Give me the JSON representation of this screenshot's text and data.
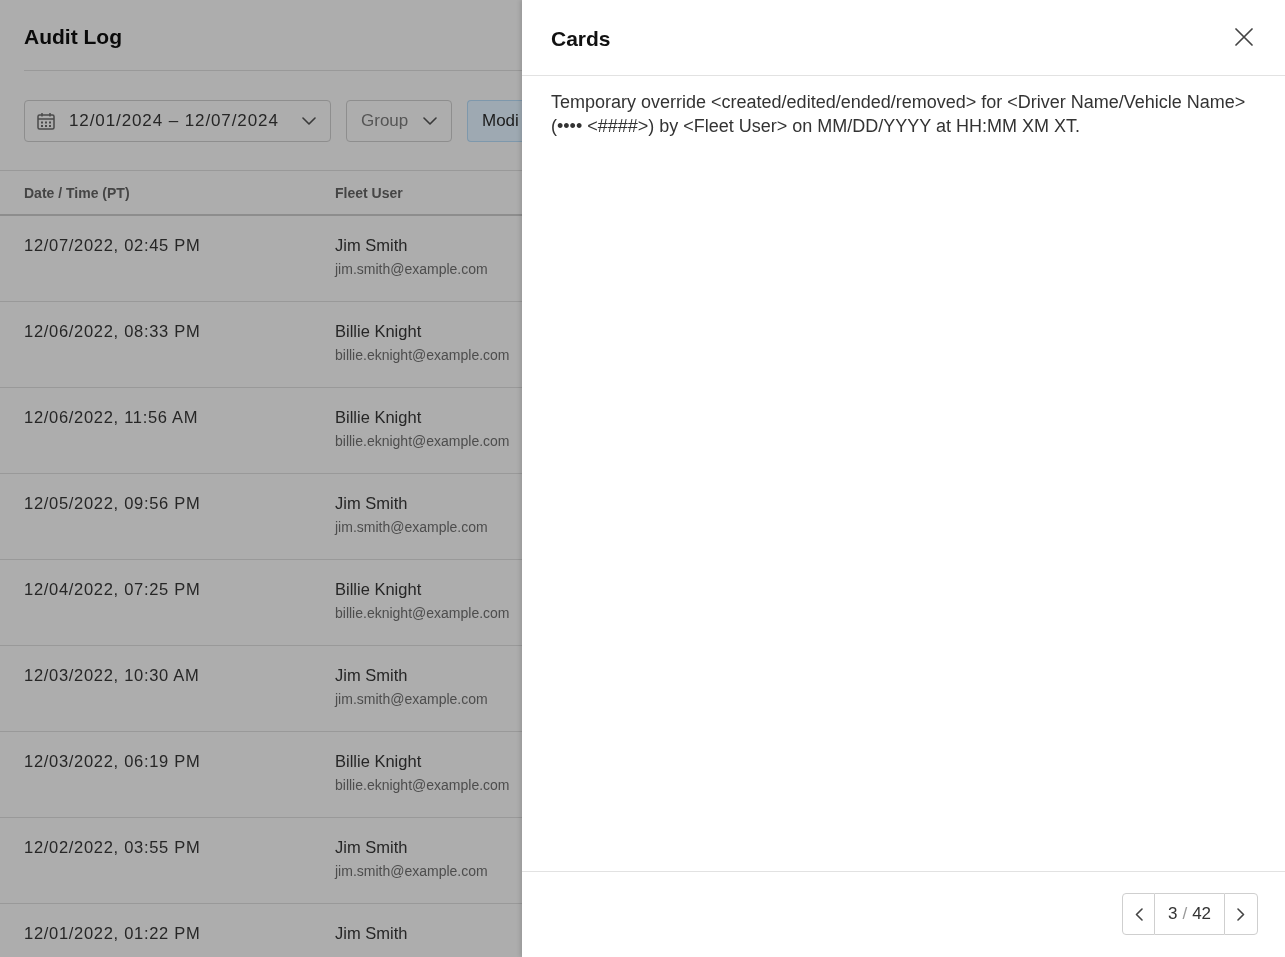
{
  "page": {
    "title": "Audit Log",
    "filters": {
      "date_range": {
        "value": "12/01/2024 – 12/07/2024"
      },
      "group": {
        "placeholder": "Group"
      },
      "button": {
        "label": "Modi"
      }
    },
    "table": {
      "columns": [
        "Date / Time (PT)",
        "Fleet User"
      ],
      "rows": [
        {
          "date_time": "12/07/2022, 02:45 PM",
          "user_name": "Jim Smith",
          "user_email": "jim.smith@example.com"
        },
        {
          "date_time": "12/06/2022, 08:33 PM",
          "user_name": "Billie Knight",
          "user_email": "billie.eknight@example.com"
        },
        {
          "date_time": "12/06/2022, 11:56 AM",
          "user_name": "Billie Knight",
          "user_email": "billie.eknight@example.com"
        },
        {
          "date_time": "12/05/2022, 09:56 PM",
          "user_name": "Jim Smith",
          "user_email": "jim.smith@example.com"
        },
        {
          "date_time": "12/04/2022, 07:25 PM",
          "user_name": "Billie Knight",
          "user_email": "billie.eknight@example.com"
        },
        {
          "date_time": "12/03/2022, 10:30 AM",
          "user_name": "Jim Smith",
          "user_email": "jim.smith@example.com"
        },
        {
          "date_time": "12/03/2022, 06:19 PM",
          "user_name": "Billie Knight",
          "user_email": "billie.eknight@example.com"
        },
        {
          "date_time": "12/02/2022, 03:55 PM",
          "user_name": "Jim Smith",
          "user_email": "jim.smith@example.com"
        },
        {
          "date_time": "12/01/2022, 01:22 PM",
          "user_name": "Jim Smith"
        }
      ]
    }
  },
  "drawer": {
    "title": "Cards",
    "message": "Temporary override <created/edited/ended/removed> for <Driver Name/Vehicle Name> (•••• <####>) by <Fleet User> on MM/DD/YYYY at HH:MM XM XT.",
    "pagination": {
      "current": "3",
      "separator": "/",
      "total": "42"
    }
  }
}
